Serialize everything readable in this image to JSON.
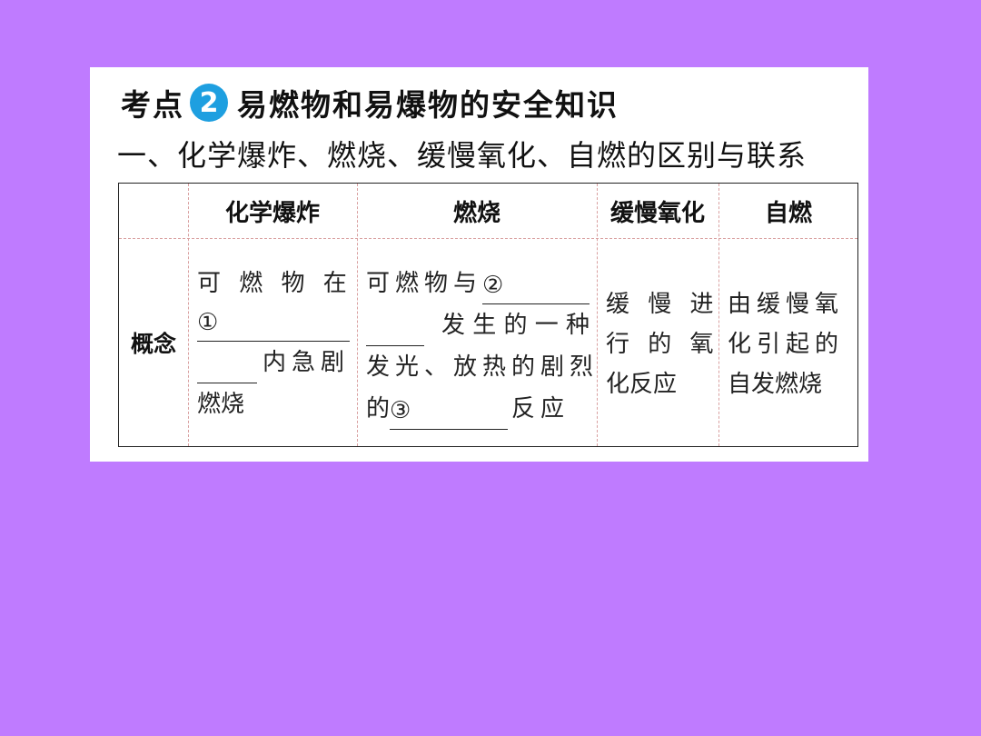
{
  "heading": {
    "prefix": "考点",
    "badge": "2",
    "title": "易燃物和易爆物的安全知识"
  },
  "subheading": "一、化学爆炸、燃烧、缓慢氧化、自燃的区别与联系",
  "table": {
    "headers": [
      "化学爆炸",
      "燃烧",
      "缓慢氧化",
      "自燃"
    ],
    "row_label": "概念",
    "explosion": {
      "line1": "可 燃 物 在",
      "marker": "①",
      "line3_suffix": "内急剧",
      "line4": "燃烧"
    },
    "combustion": {
      "line1_prefix": "可燃物与",
      "marker1": "②",
      "line2_suffix": "发 生 的 一 种",
      "line3": "发光、放热的剧烈",
      "line4_prefix": "的",
      "marker2": "③",
      "line4_suffix": "反应"
    },
    "slow_oxidation": {
      "line1": "缓 慢 进",
      "line2": "行 的 氧",
      "line3": "化反应"
    },
    "spontaneous": {
      "line1": "由缓慢氧",
      "line2": "化引起的",
      "line3": "自发燃烧"
    }
  }
}
